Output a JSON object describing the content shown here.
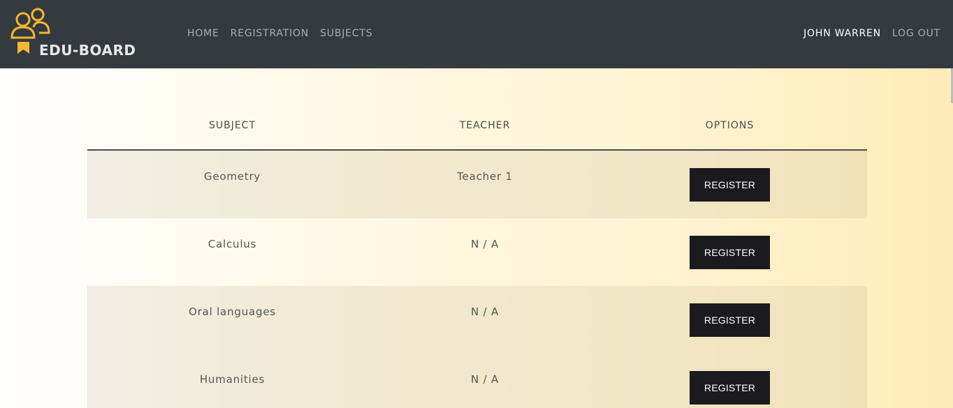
{
  "brand": {
    "name": "EDU-BOARD",
    "accent_color": "#f5b731",
    "icon": "users-badge-icon"
  },
  "nav": {
    "links": [
      "HOME",
      "REGISTRATION",
      "SUBJECTS"
    ],
    "user": "JOHN WARREN",
    "logout": "LOG OUT"
  },
  "table": {
    "headers": [
      "SUBJECT",
      "TEACHER",
      "OPTIONS"
    ],
    "rows": [
      {
        "subject": "Geometry",
        "teacher": "Teacher 1",
        "action": "REGISTER"
      },
      {
        "subject": "Calculus",
        "teacher": "N / A",
        "action": "REGISTER"
      },
      {
        "subject": "Oral languages",
        "teacher": "N / A",
        "action": "REGISTER"
      },
      {
        "subject": "Humanities",
        "teacher": "N / A",
        "action": "REGISTER"
      }
    ]
  }
}
